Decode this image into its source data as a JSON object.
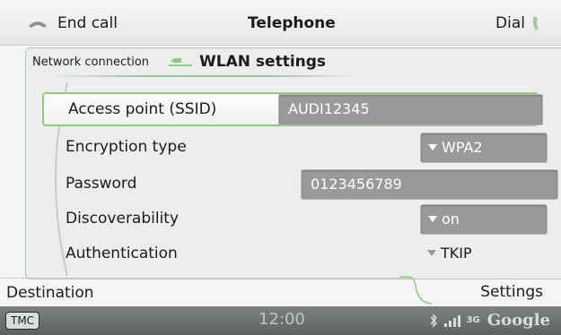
{
  "topbar": {
    "end_call_label": "End call",
    "title": "Telephone",
    "dial_label": "Dial"
  },
  "menu": {
    "parent": "Network connection",
    "title": "WLAN settings",
    "rows": [
      {
        "label": "Access point (SSID)",
        "value": "AUDI12345",
        "type": "text",
        "selected": true
      },
      {
        "label": "Encryption type",
        "value": "WPA2",
        "type": "dropdown"
      },
      {
        "label": "Password",
        "value": "0123456789",
        "type": "text"
      },
      {
        "label": "Discoverability",
        "value": "on",
        "type": "dropdown"
      },
      {
        "label": "Authentication",
        "value": "TKIP",
        "type": "dropdown-plain"
      }
    ]
  },
  "tabs": {
    "left": "Destination",
    "right": "Settings"
  },
  "statusbar": {
    "tmc": "TMC",
    "time": "12:00",
    "network": "3G",
    "brand": "Google"
  },
  "colors": {
    "accent_green": "#8ecc7c",
    "field_grey": "#9a9a9a",
    "status_bar": "#6e7272"
  }
}
